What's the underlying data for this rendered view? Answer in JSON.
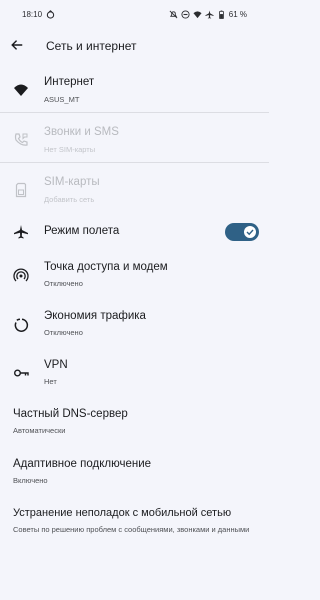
{
  "status_bar": {
    "time": "18:10",
    "battery": "61 %"
  },
  "app_bar": {
    "title": "Сеть и интернет"
  },
  "items": [
    {
      "label": "Интернет",
      "sub": "ASUS_MT"
    },
    {
      "label": "Звонки и SMS",
      "sub": "Нет SIM-карты"
    },
    {
      "label": "SIM-карты",
      "sub": "Добавить сеть"
    },
    {
      "label": "Режим полета",
      "toggle_on": true
    },
    {
      "label": "Точка доступа и модем",
      "sub": "Отключено"
    },
    {
      "label": "Экономия трафика",
      "sub": "Отключено"
    },
    {
      "label": "VPN",
      "sub": "Нет"
    },
    {
      "label": "Частный DNS-сервер",
      "sub": "Автоматически"
    },
    {
      "label": "Адаптивное подключение",
      "sub": "Включено"
    },
    {
      "label": "Устранение неполадок с мобильной сетью",
      "sub": "Советы по решению проблем с сообщениями, звонками и данными"
    }
  ],
  "colors": {
    "accent": "#2f6186",
    "background": "#f4f5fb"
  }
}
